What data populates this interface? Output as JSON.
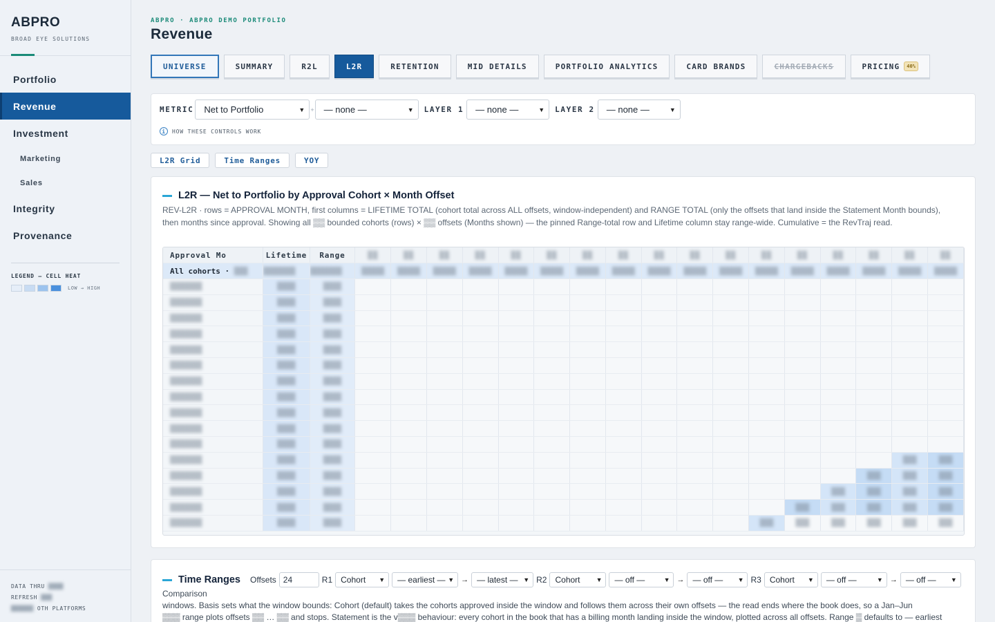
{
  "brand": {
    "name": "ABPRO",
    "subtitle": "BROAD EYE SOLUTIONS"
  },
  "sidebar": {
    "items": [
      {
        "label": "Portfolio",
        "level": 1,
        "active": false
      },
      {
        "label": "Revenue",
        "level": 1,
        "active": true
      },
      {
        "label": "Investment",
        "level": 1,
        "active": false
      },
      {
        "label": "Marketing",
        "level": 2,
        "active": false
      },
      {
        "label": "Sales",
        "level": 2,
        "active": false
      },
      {
        "label": "Integrity",
        "level": 1,
        "active": false
      },
      {
        "label": "Provenance",
        "level": 1,
        "active": false
      }
    ],
    "legend_title": "LEGEND — CELL HEAT",
    "legend_scale": "LOW → HIGH",
    "legend_colors": [
      "#e6eef8",
      "#c8dcf3",
      "#9cc3ee",
      "#4a90dd"
    ],
    "footer": {
      "data_thru": "DATA THRU",
      "refresh": "REFRESH",
      "platforms": "OTH PLATFORMS"
    }
  },
  "header": {
    "breadcrumb": "ABPRO · ABPRO DEMO PORTFOLIO",
    "title": "Revenue"
  },
  "tabs": [
    {
      "label": "UNIVERSE",
      "state": "outlined"
    },
    {
      "label": "SUMMARY",
      "state": "normal"
    },
    {
      "label": "R2L",
      "state": "normal"
    },
    {
      "label": "L2R",
      "state": "active"
    },
    {
      "label": "RETENTION",
      "state": "normal"
    },
    {
      "label": "MID DETAILS",
      "state": "normal"
    },
    {
      "label": "PORTFOLIO ANALYTICS",
      "state": "normal"
    },
    {
      "label": "CARD BRANDS",
      "state": "normal"
    },
    {
      "label": "CHARGEBACKS",
      "state": "disabled"
    },
    {
      "label": "PRICING",
      "state": "normal",
      "badge": "40%"
    }
  ],
  "controls": {
    "metric_label": "METRIC",
    "metric_value": "Net to Portfolio",
    "metric2_value": "— none —",
    "layer1_label": "LAYER 1",
    "layer1_value": "— none —",
    "layer2_label": "LAYER 2",
    "layer2_value": "— none —",
    "help_text": "HOW THESE CONTROLS WORK"
  },
  "subtabs": [
    "L2R Grid",
    "Time Ranges",
    "YOY"
  ],
  "l2r": {
    "title": "L2R — Net to Portfolio by Approval Cohort × Month Offset",
    "description": "REV-L2R · rows = APPROVAL MONTH, first columns = LIFETIME TOTAL (cohort total across ALL offsets, window-independent) and RANGE TOTAL (only the offsets that land inside the Statement Month bounds), then months since approval. Showing all ▒▒ bounded cohorts (rows) × ▒▒ offsets (Months shown) — the pinned Range-total row and Lifetime column stay range-wide. Cumulative = the RevTraj read.",
    "headers": {
      "approval": "Approval Mo",
      "lifetime": "Lifetime",
      "range": "Range"
    },
    "all_cohorts_label": "All cohorts ·"
  },
  "time_ranges": {
    "title": "Time Ranges",
    "offsets_label": "Offsets",
    "offsets_value": "24",
    "r1": "R1",
    "r1_basis": "Cohort",
    "r1_start": "— earliest —",
    "r1_end": "— latest —",
    "r2": "R2",
    "r2_basis": "Cohort",
    "r2_start": "— off —",
    "r2_end": "— off —",
    "r3": "R3",
    "r3_basis": "Cohort",
    "r3_start": "— off —",
    "r3_end": "— off —",
    "comparison_label": "Comparison",
    "desc_line1": "windows. Basis sets what the window bounds: Cohort (default) takes the cohorts approved inside the window and follows them across their own offsets — the read ends where the book does, so a Jan–Jun",
    "desc_line2": "▒▒▒ range plots offsets ▒▒ … ▒▒ and stops. Statement is the v▒▒▒ behaviour: every cohort in the book that has a billing month landing inside the window, plotted across all offsets. Range ▒ defaults to — earliest"
  }
}
